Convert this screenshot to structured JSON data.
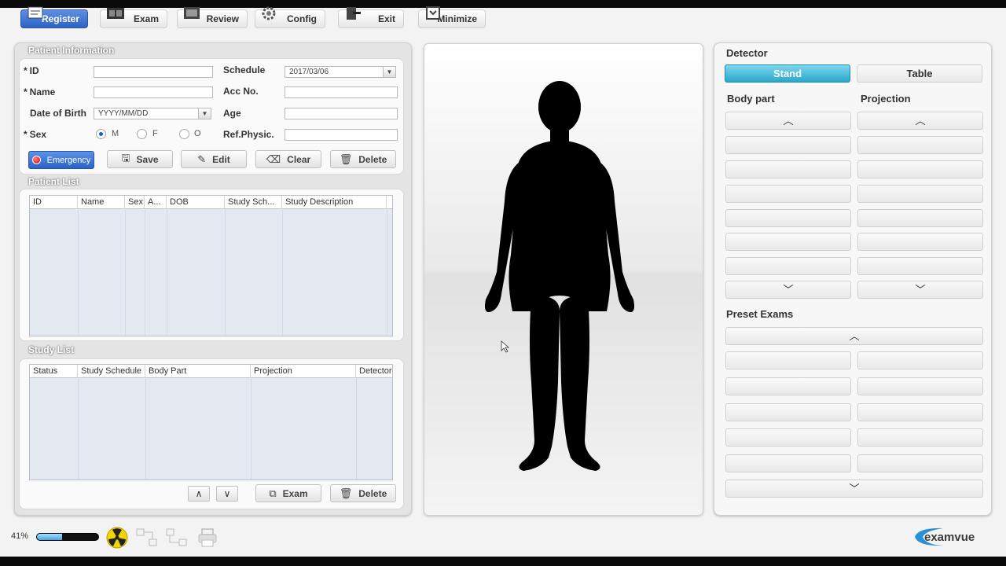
{
  "toolbar": {
    "register": "Register",
    "exam": "Exam",
    "review": "Review",
    "config": "Config",
    "exit": "Exit",
    "minimize": "Minimize"
  },
  "patient_info": {
    "title": "Patient Information",
    "id_label": "ID",
    "name_label": "Name",
    "dob_label": "Date of Birth",
    "dob_value": "YYYY/MM/DD",
    "sex_label": "Sex",
    "sex_options": [
      "M",
      "F",
      "O"
    ],
    "sex_selected": "M",
    "schedule_label": "Schedule",
    "schedule_value": "2017/03/06",
    "acc_label": "Acc No.",
    "age_label": "Age",
    "refphys_label": "Ref.Physic.",
    "required_mark": "*",
    "buttons": {
      "emergency": "Emergency",
      "save": "Save",
      "edit": "Edit",
      "clear": "Clear",
      "delete": "Delete"
    }
  },
  "patient_list": {
    "title": "Patient List",
    "columns": [
      "ID",
      "Name",
      "Sex",
      "A...",
      "DOB",
      "Study Sch...",
      "Study Description"
    ]
  },
  "study_list": {
    "title": "Study List",
    "columns": [
      "Status",
      "Study Schedule",
      "Body Part",
      "Projection",
      "Detector"
    ],
    "buttons": {
      "up": "∧",
      "down": "∨",
      "exam": "Exam",
      "delete": "Delete"
    }
  },
  "detector": {
    "title": "Detector",
    "options": [
      "Stand",
      "Table"
    ],
    "selected": "Stand"
  },
  "body_part": {
    "title": "Body part"
  },
  "projection": {
    "title": "Projection"
  },
  "preset_exams": {
    "title": "Preset Exams"
  },
  "status": {
    "progress_label": "41%",
    "progress": 0.41
  },
  "logo": {
    "text": "examvue"
  },
  "colors": {
    "accent_blue": "#2f63c4",
    "detector_selected": "#2aa8cc"
  }
}
